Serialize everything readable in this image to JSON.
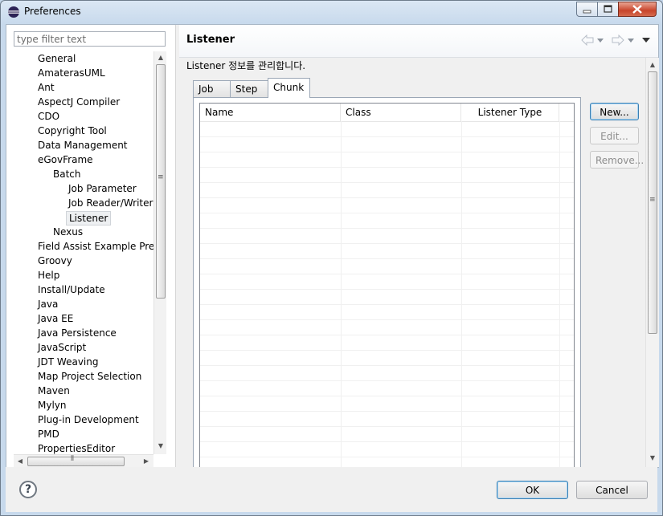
{
  "window": {
    "title": "Preferences"
  },
  "filter": {
    "placeholder": "type filter text"
  },
  "tree": [
    {
      "label": "General",
      "level": 0
    },
    {
      "label": "AmaterasUML",
      "level": 0
    },
    {
      "label": "Ant",
      "level": 0
    },
    {
      "label": "AspectJ Compiler",
      "level": 0
    },
    {
      "label": "CDO",
      "level": 0
    },
    {
      "label": "Copyright Tool",
      "level": 0
    },
    {
      "label": "Data Management",
      "level": 0
    },
    {
      "label": "eGovFrame",
      "level": 0
    },
    {
      "label": "Batch",
      "level": 1
    },
    {
      "label": "Job Parameter",
      "level": 2
    },
    {
      "label": "Job Reader/Writer",
      "level": 2
    },
    {
      "label": "Listener",
      "level": 2,
      "selected": true
    },
    {
      "label": "Nexus",
      "level": 1
    },
    {
      "label": "Field Assist Example Preferences",
      "level": 0
    },
    {
      "label": "Groovy",
      "level": 0
    },
    {
      "label": "Help",
      "level": 0
    },
    {
      "label": "Install/Update",
      "level": 0
    },
    {
      "label": "Java",
      "level": 0
    },
    {
      "label": "Java EE",
      "level": 0
    },
    {
      "label": "Java Persistence",
      "level": 0
    },
    {
      "label": "JavaScript",
      "level": 0
    },
    {
      "label": "JDT Weaving",
      "level": 0
    },
    {
      "label": "Map Project Selection",
      "level": 0
    },
    {
      "label": "Maven",
      "level": 0
    },
    {
      "label": "Mylyn",
      "level": 0
    },
    {
      "label": "Plug-in Development",
      "level": 0
    },
    {
      "label": "PMD",
      "level": 0
    },
    {
      "label": "PropertiesEditor",
      "level": 0
    }
  ],
  "page": {
    "title": "Listener",
    "description": "Listener 정보를 관리합니다."
  },
  "tabs": [
    {
      "label": "Job"
    },
    {
      "label": "Step"
    },
    {
      "label": "Chunk",
      "active": true
    }
  ],
  "table": {
    "columns": [
      "Name",
      "Class",
      "Listener Type"
    ],
    "rows": []
  },
  "side_buttons": {
    "new": "New...",
    "edit": "Edit...",
    "remove": "Remove..."
  },
  "footer": {
    "help": "?",
    "ok": "OK",
    "cancel": "Cancel"
  },
  "icons": {
    "nav_back": "arrow-left-icon",
    "nav_forward": "arrow-right-icon",
    "view_menu": "triangle-down-icon",
    "scroll_grip": "grip-icon"
  }
}
